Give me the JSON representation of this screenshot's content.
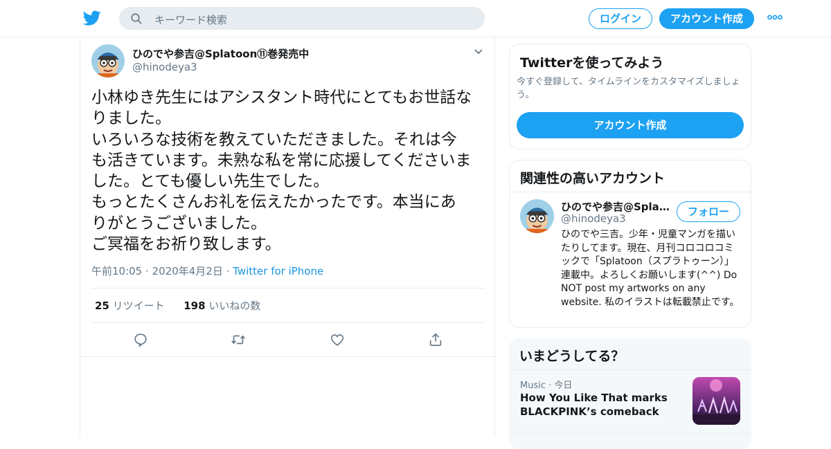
{
  "header": {
    "search_placeholder": "キーワード検索",
    "login_label": "ログイン",
    "signup_label": "アカウント作成"
  },
  "tweet": {
    "author_name": "ひのでや参吉@Splatoon⑪巻発売中",
    "author_handle": "@hinodeya3",
    "text_lines": [
      "小林ゆき先生にはアシスタント時代にとてもお世話な",
      "りました。",
      "いろいろな技術を教えていただきました。それは今",
      "も活きています。未熟な私を常に応援してくださいま",
      "した。とても優しい先生でした。",
      "もっとたくさんお礼を伝えたかったです。本当にあ",
      "りがとうございました。",
      "ご冥福をお祈り致します。"
    ],
    "time": "午前10:05",
    "date": "2020年4月2日",
    "source": "Twitter for iPhone",
    "retweet_count": "25",
    "retweet_label": "リツイート",
    "like_count": "198",
    "like_label": "いいねの数"
  },
  "sidebar": {
    "signup_card": {
      "title": "Twitterを使ってみよう",
      "subtitle": "今すぐ登録して、タイムラインをカスタマイズしましょう。",
      "button_label": "アカウント作成"
    },
    "related_card": {
      "title": "関連性の高いアカウント",
      "name": "ひのでや参吉@Splatoon⑪巻発売中",
      "handle": "@hinodeya3",
      "follow_label": "フォロー",
      "bio": "ひのでや三吉。少年・児童マンガを描いたりしてます。現在、月刊コロコロコミックで「Splatoon（スプラトゥーン）」連載中。よろしくお願いします(^^) Do NOT post my artworks on any website. 私のイラストは転載禁止です。"
    },
    "trends_card": {
      "title": "いまどうしてる？",
      "category": "Music",
      "time": "今日",
      "headline": "How You Like That marks BLACKPINK’s comeback"
    }
  },
  "colors": {
    "accent": "#1da1f2",
    "text": "#14171a",
    "secondary": "#657786",
    "border": "#e6ecf0"
  }
}
